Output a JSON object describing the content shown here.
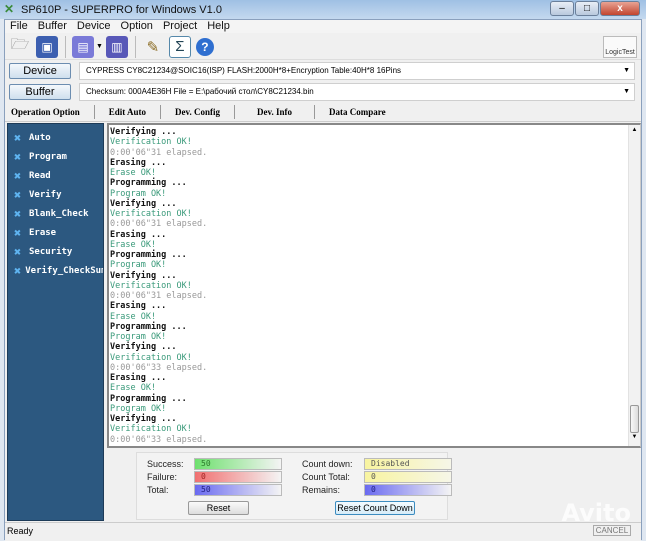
{
  "window": {
    "title": "SP610P - SUPERPRO for Windows V1.0"
  },
  "menu": [
    "File",
    "Buffer",
    "Device",
    "Option",
    "Project",
    "Help"
  ],
  "toolbar": {
    "icons": [
      "open-icon",
      "save-icon",
      "load-chip-icon",
      "dropdown-icon",
      "save-chip-icon",
      "edit-auto-icon",
      "checksum-icon",
      "help-icon"
    ],
    "logic_test": "LogicTest"
  },
  "device": {
    "button": "Device",
    "value": "CYPRESS  CY8C21234@SOIC16(ISP)  FLASH:2000H*8+Encryption Table:40H*8  16Pins"
  },
  "buffer": {
    "button": "Buffer",
    "value": "Checksum: 000A4E36H    File = E:\\рабочий стол\\CY8C21234.bin"
  },
  "tabs": [
    "Operation Option",
    "Edit Auto",
    "Dev. Config",
    "Dev. Info",
    "Data Compare"
  ],
  "sidebar": [
    "Auto",
    "Program",
    "Read",
    "Verify",
    "Blank_Check",
    "Erase",
    "Security",
    "Verify_CheckSum"
  ],
  "log": [
    {
      "t": "act",
      "s": "Verifying ..."
    },
    {
      "t": "ok",
      "s": "Verification OK!"
    },
    {
      "t": "time",
      "s": "0:00'06\"31 elapsed."
    },
    {
      "t": "act",
      "s": "Erasing ..."
    },
    {
      "t": "ok",
      "s": "Erase OK!"
    },
    {
      "t": "act",
      "s": "Programming ..."
    },
    {
      "t": "ok",
      "s": "Program OK!"
    },
    {
      "t": "act",
      "s": "Verifying ..."
    },
    {
      "t": "ok",
      "s": "Verification OK!"
    },
    {
      "t": "time",
      "s": "0:00'06\"31 elapsed."
    },
    {
      "t": "act",
      "s": "Erasing ..."
    },
    {
      "t": "ok",
      "s": "Erase OK!"
    },
    {
      "t": "act",
      "s": "Programming ..."
    },
    {
      "t": "ok",
      "s": "Program OK!"
    },
    {
      "t": "act",
      "s": "Verifying ..."
    },
    {
      "t": "ok",
      "s": "Verification OK!"
    },
    {
      "t": "time",
      "s": "0:00'06\"31 elapsed."
    },
    {
      "t": "act",
      "s": "Erasing ..."
    },
    {
      "t": "ok",
      "s": "Erase OK!"
    },
    {
      "t": "act",
      "s": "Programming ..."
    },
    {
      "t": "ok",
      "s": "Program OK!"
    },
    {
      "t": "act",
      "s": "Verifying ..."
    },
    {
      "t": "ok",
      "s": "Verification OK!"
    },
    {
      "t": "time",
      "s": "0:00'06\"33 elapsed."
    },
    {
      "t": "act",
      "s": "Erasing ..."
    },
    {
      "t": "ok",
      "s": "Erase OK!"
    },
    {
      "t": "act",
      "s": "Programming ..."
    },
    {
      "t": "ok",
      "s": "Program OK!"
    },
    {
      "t": "act",
      "s": "Verifying ..."
    },
    {
      "t": "ok",
      "s": "Verification OK!"
    },
    {
      "t": "time",
      "s": "0:00'06\"33 elapsed."
    }
  ],
  "stats": {
    "success_label": "Success:",
    "success": "50",
    "failure_label": "Failure:",
    "failure": "0",
    "total_label": "Total:",
    "total": "50",
    "reset": "Reset",
    "countdown_label": "Count down:",
    "countdown": "Disabled",
    "counttotal_label": "Count Total:",
    "counttotal": "0",
    "remains_label": "Remains:",
    "remains": "0",
    "reset_countdown": "Reset Count Down"
  },
  "colors": {
    "sidebar": "#2c5880",
    "ok": "#3a9a7a",
    "success": "#6ee06e",
    "failure": "#f07070",
    "total": "#6a6af0",
    "countdown": "#f8f4a0"
  },
  "status": "Ready",
  "watermark": "Avito",
  "cancel": "CANCEL"
}
